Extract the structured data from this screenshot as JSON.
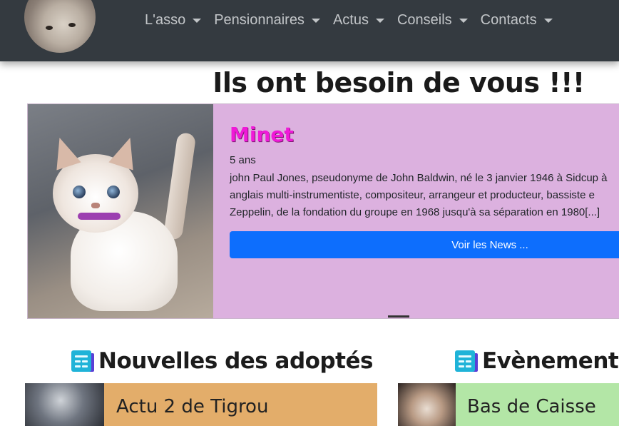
{
  "nav": {
    "items": [
      {
        "label": "L'asso"
      },
      {
        "label": "Pensionnaires"
      },
      {
        "label": "Actus"
      },
      {
        "label": "Conseils"
      },
      {
        "label": "Contacts"
      }
    ]
  },
  "page": {
    "heading": "Ils ont besoin de vous !!!"
  },
  "carousel": {
    "name": "Minet",
    "age": "5 ans",
    "description_lines": [
      "john Paul Jones, pseudonyme de John Baldwin, né le 3 janvier 1946 à Sidcup à",
      "anglais multi-instrumentiste, compositeur, arrangeur et producteur, bassiste e",
      "Zeppelin, de la fondation du groupe en 1968 jusqu'à sa séparation en 1980[...]"
    ],
    "button_label": "Voir les News ..."
  },
  "sections": {
    "adopted": {
      "title": "Nouvelles des adoptés",
      "card_title": "Actu 2 de Tigrou"
    },
    "events": {
      "title": "Evènements",
      "card_title": "Bas de Caisse"
    }
  },
  "colors": {
    "navbar": "#343a40",
    "carousel_bg": "#dcb1df",
    "name_accent": "#f01ad8",
    "button": "#0d6efd",
    "adopted_card_bg": "#e3ad6a",
    "events_card_bg": "#b3e6a6",
    "news_icon": "#1fb3d8"
  },
  "icons": {
    "nav_dropdown": "caret-down-icon",
    "section": "newspaper-icon"
  }
}
